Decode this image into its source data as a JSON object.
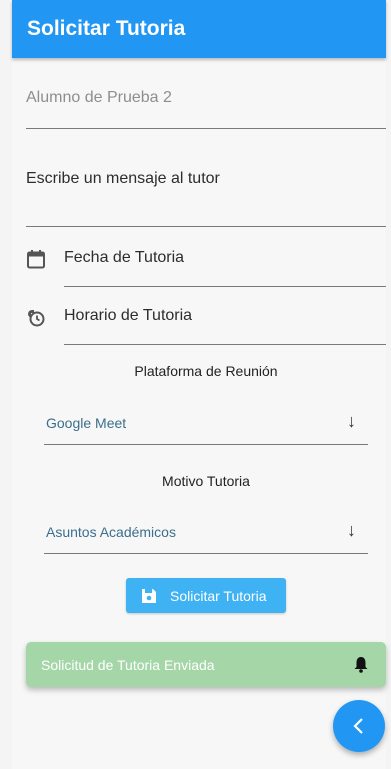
{
  "appbar": {
    "title": "Solicitar Tutoria"
  },
  "form": {
    "student": "Alumno de Prueba 2",
    "message_placeholder": "Escribe un mensaje al tutor",
    "date_label": "Fecha de Tutoria",
    "time_label": "Horario de Tutoria",
    "platform_label": "Plataforma de Reunión",
    "platform_value": "Google Meet",
    "reason_label": "Motivo Tutoria",
    "reason_value": "Asuntos Académicos",
    "submit_label": "Solicitar Tutoria"
  },
  "snackbar": {
    "text": "Solicitud de Tutoria Enviada"
  },
  "colors": {
    "primary": "#2196f3",
    "button": "#3fb2f3",
    "snackbar": "#a5d6a7"
  },
  "icons": [
    "calendar-icon",
    "clock-icon",
    "arrow-down-icon",
    "save-icon",
    "bell-icon",
    "chevron-left-icon"
  ]
}
